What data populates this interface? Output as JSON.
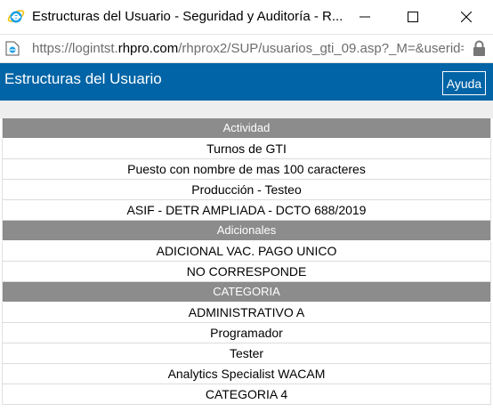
{
  "window": {
    "title": "Estructuras del Usuario - Seguridad y Auditoría - R...",
    "minimize_glyph": "—",
    "maximize_glyph": "☐",
    "close_glyph": "✕"
  },
  "address": {
    "url_prefix": "https://logintst.",
    "url_host": "rhpro.com",
    "url_path": "/rhprox2/SUP/usuarios_gti_09.asp?_M=&userid="
  },
  "header": {
    "title": "Estructuras del Usuario",
    "help_label": "Ayuda"
  },
  "sections": [
    {
      "title": "Actividad",
      "items": [
        "Turnos de GTI",
        "Puesto con nombre de mas 100 caracteres",
        "Producción - Testeo",
        "ASIF - DETR AMPLIADA - DCTO 688/2019"
      ]
    },
    {
      "title": "Adicionales",
      "items": [
        "ADICIONAL VAC. PAGO UNICO",
        "NO CORRESPONDE"
      ]
    },
    {
      "title": "CATEGORIA",
      "items": [
        "ADMINISTRATIVO A",
        "Programador",
        "Tester",
        "Analytics Specialist WACAM",
        "CATEGORIA 4"
      ]
    }
  ],
  "colors": {
    "header_bg": "#0064a6",
    "section_bg": "#8c8c8c",
    "ie_blue": "#1ea1e6",
    "ie_ring": "#f4c20d"
  },
  "icons": [
    "ie-icon",
    "page-icon",
    "lock-icon",
    "minimize-icon",
    "maximize-icon",
    "close-icon"
  ]
}
